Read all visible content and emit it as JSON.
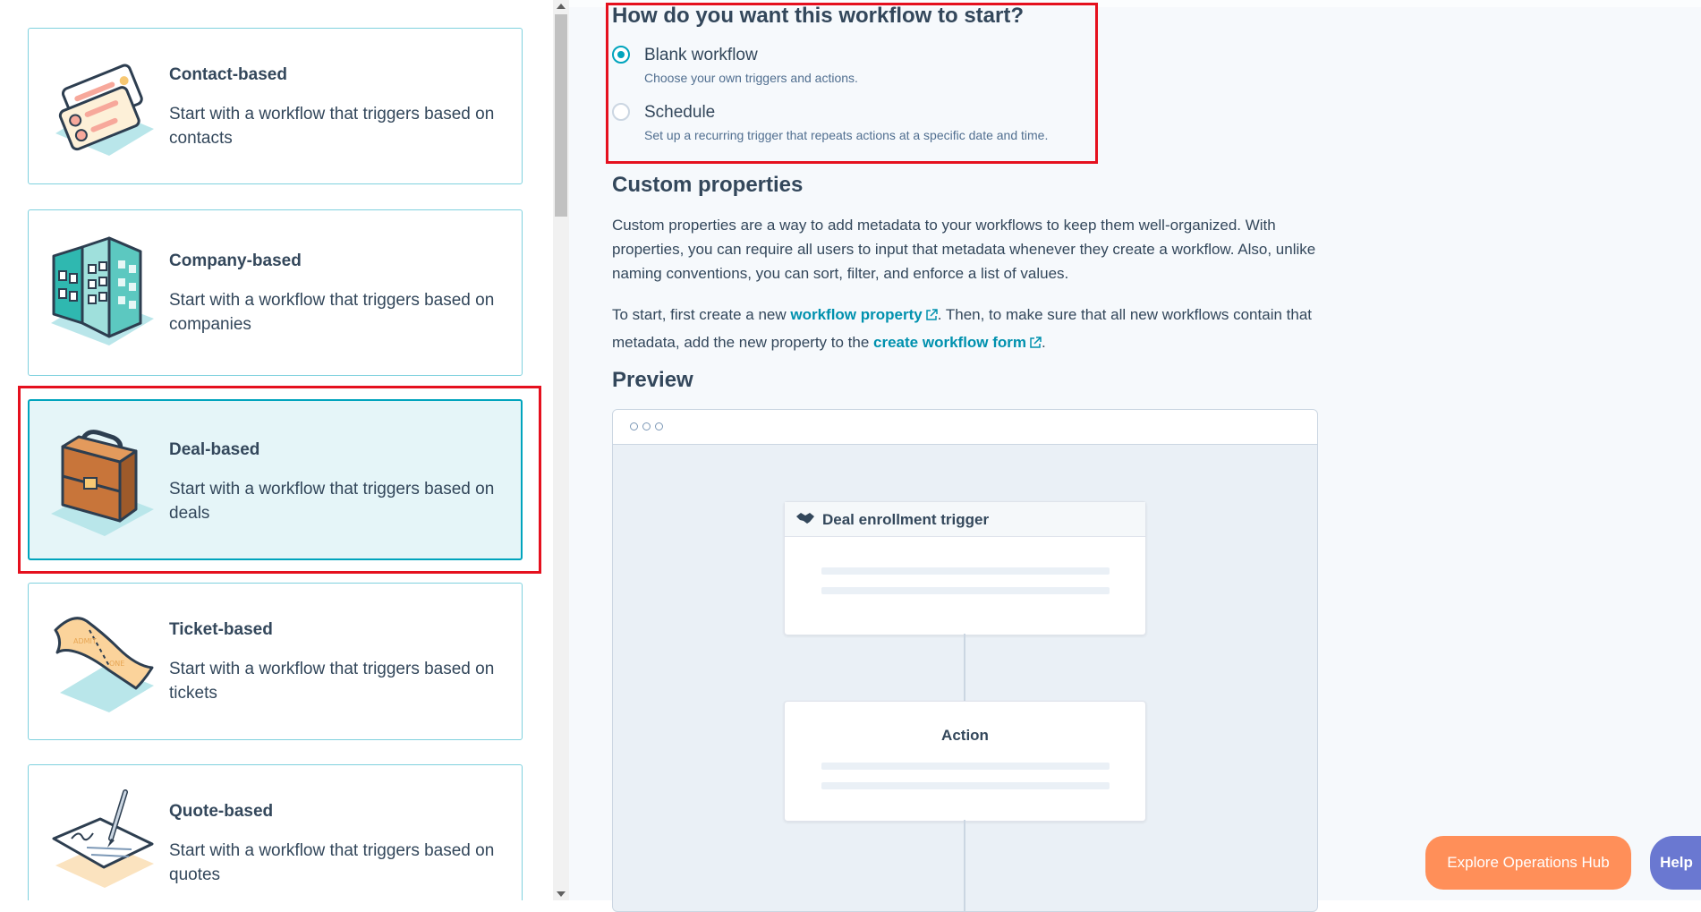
{
  "cards": [
    {
      "title": "Contact-based",
      "desc": "Start with a workflow that triggers based on contacts",
      "icon": "contact-cards-icon"
    },
    {
      "title": "Company-based",
      "desc": "Start with a workflow that triggers based on companies",
      "icon": "building-icon"
    },
    {
      "title": "Deal-based",
      "desc": "Start with a workflow that triggers based on deals",
      "icon": "briefcase-icon"
    },
    {
      "title": "Ticket-based",
      "desc": "Start with a workflow that triggers based on tickets",
      "icon": "ticket-icon"
    },
    {
      "title": "Quote-based",
      "desc": "Start with a workflow that triggers based on quotes",
      "icon": "signature-document-icon"
    }
  ],
  "start": {
    "question": "How do you want this workflow to start?",
    "options": [
      {
        "label": "Blank workflow",
        "help": "Choose your own triggers and actions.",
        "selected": true
      },
      {
        "label": "Schedule",
        "help": "Set up a recurring trigger that repeats actions at a specific date and time.",
        "selected": false
      }
    ]
  },
  "custom_properties": {
    "title": "Custom properties",
    "para1": "Custom properties are a way to add metadata to your workflows to keep them well-organized. With properties, you can require all users to input that metadata whenever they create a workflow. Also, unlike naming conventions, you can sort, filter, and enforce a list of values.",
    "para2_start": "To start, first create a new ",
    "link1": "workflow property",
    "para2_mid": ". Then, to make sure that all new workflows contain that metadata, add the new property to the ",
    "link2": "create workflow form",
    "para2_end": "."
  },
  "preview": {
    "title": "Preview",
    "trigger_label": "Deal enrollment trigger",
    "action_label": "Action"
  },
  "footer": {
    "explore_label": "Explore Operations Hub",
    "help_label": "Help"
  },
  "colors": {
    "accent": "#00a4bd",
    "link": "#0091ae",
    "highlight": "#e5101e",
    "explore": "#ff8f59",
    "help": "#6a78d1"
  }
}
